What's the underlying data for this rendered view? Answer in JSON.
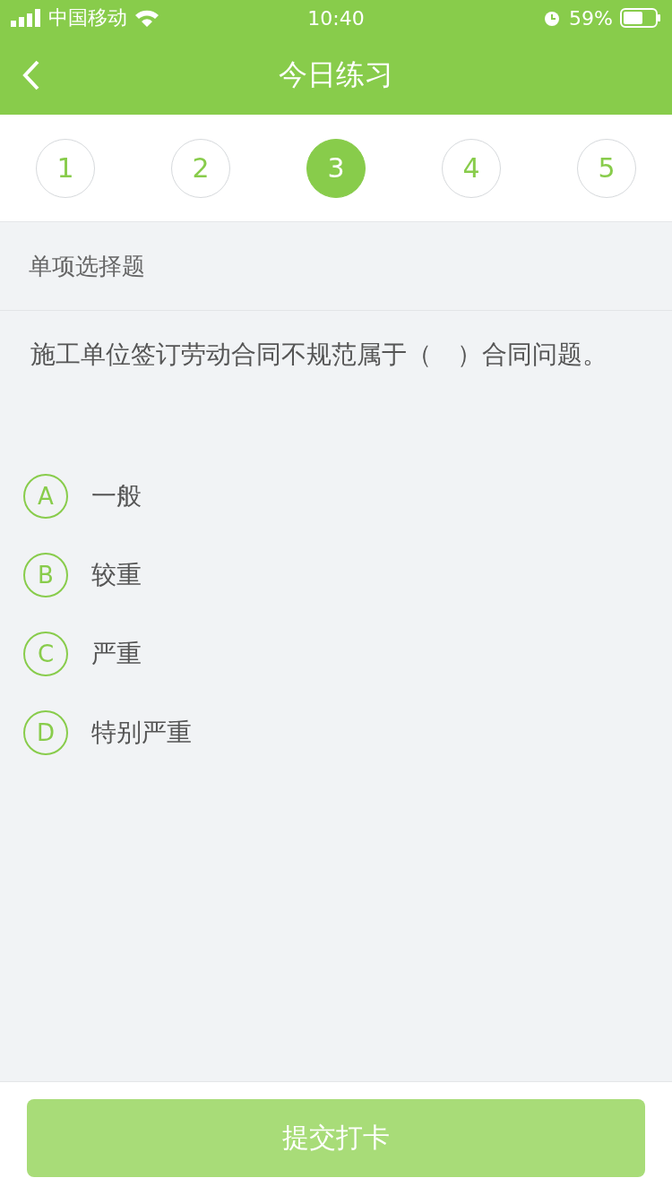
{
  "status_bar": {
    "carrier": "中国移动",
    "time": "10:40",
    "battery": "59%"
  },
  "nav": {
    "title": "今日练习"
  },
  "steps": [
    {
      "label": "1",
      "selected": false
    },
    {
      "label": "2",
      "selected": false
    },
    {
      "label": "3",
      "selected": true
    },
    {
      "label": "4",
      "selected": false
    },
    {
      "label": "5",
      "selected": false
    }
  ],
  "section": "单项选择题",
  "question": "施工单位签订劳动合同不规范属于（　）合同问题。",
  "options": [
    {
      "letter": "A",
      "text": "一般",
      "selected": false
    },
    {
      "letter": "B",
      "text": "较重",
      "selected": false
    },
    {
      "letter": "C",
      "text": "严重",
      "selected": false
    },
    {
      "letter": "D",
      "text": "特别严重",
      "selected": false
    }
  ],
  "submit": {
    "label": "提交打卡",
    "disabled": true
  }
}
